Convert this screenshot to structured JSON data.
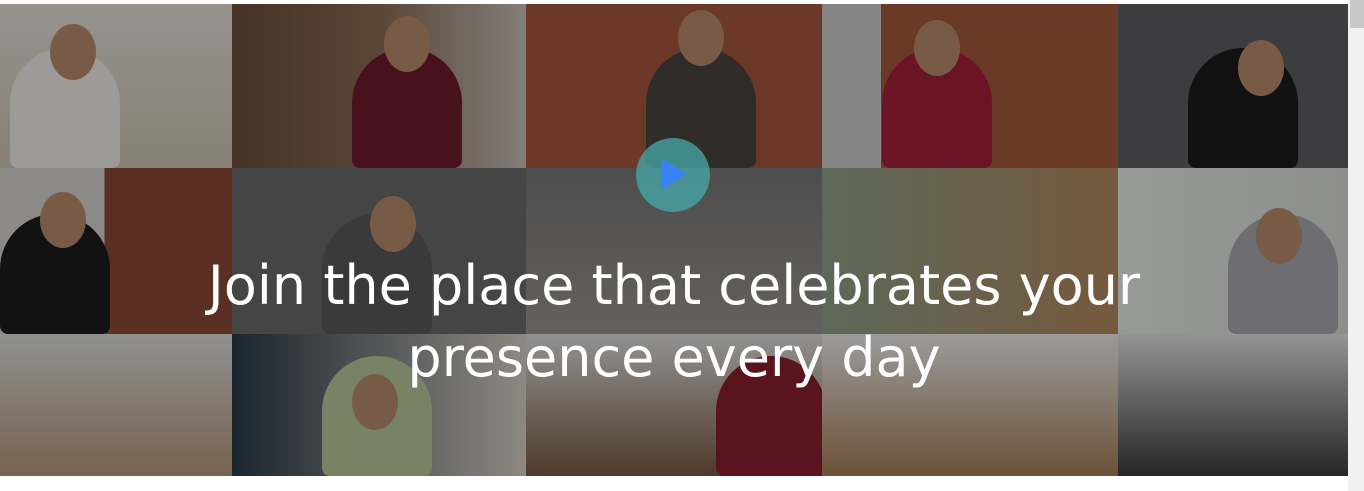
{
  "hero": {
    "headline_line1": "Join the place that celebrates your",
    "headline_line2": "presence every day",
    "play_icon": "play-icon",
    "play_color": "#3b82f6"
  }
}
